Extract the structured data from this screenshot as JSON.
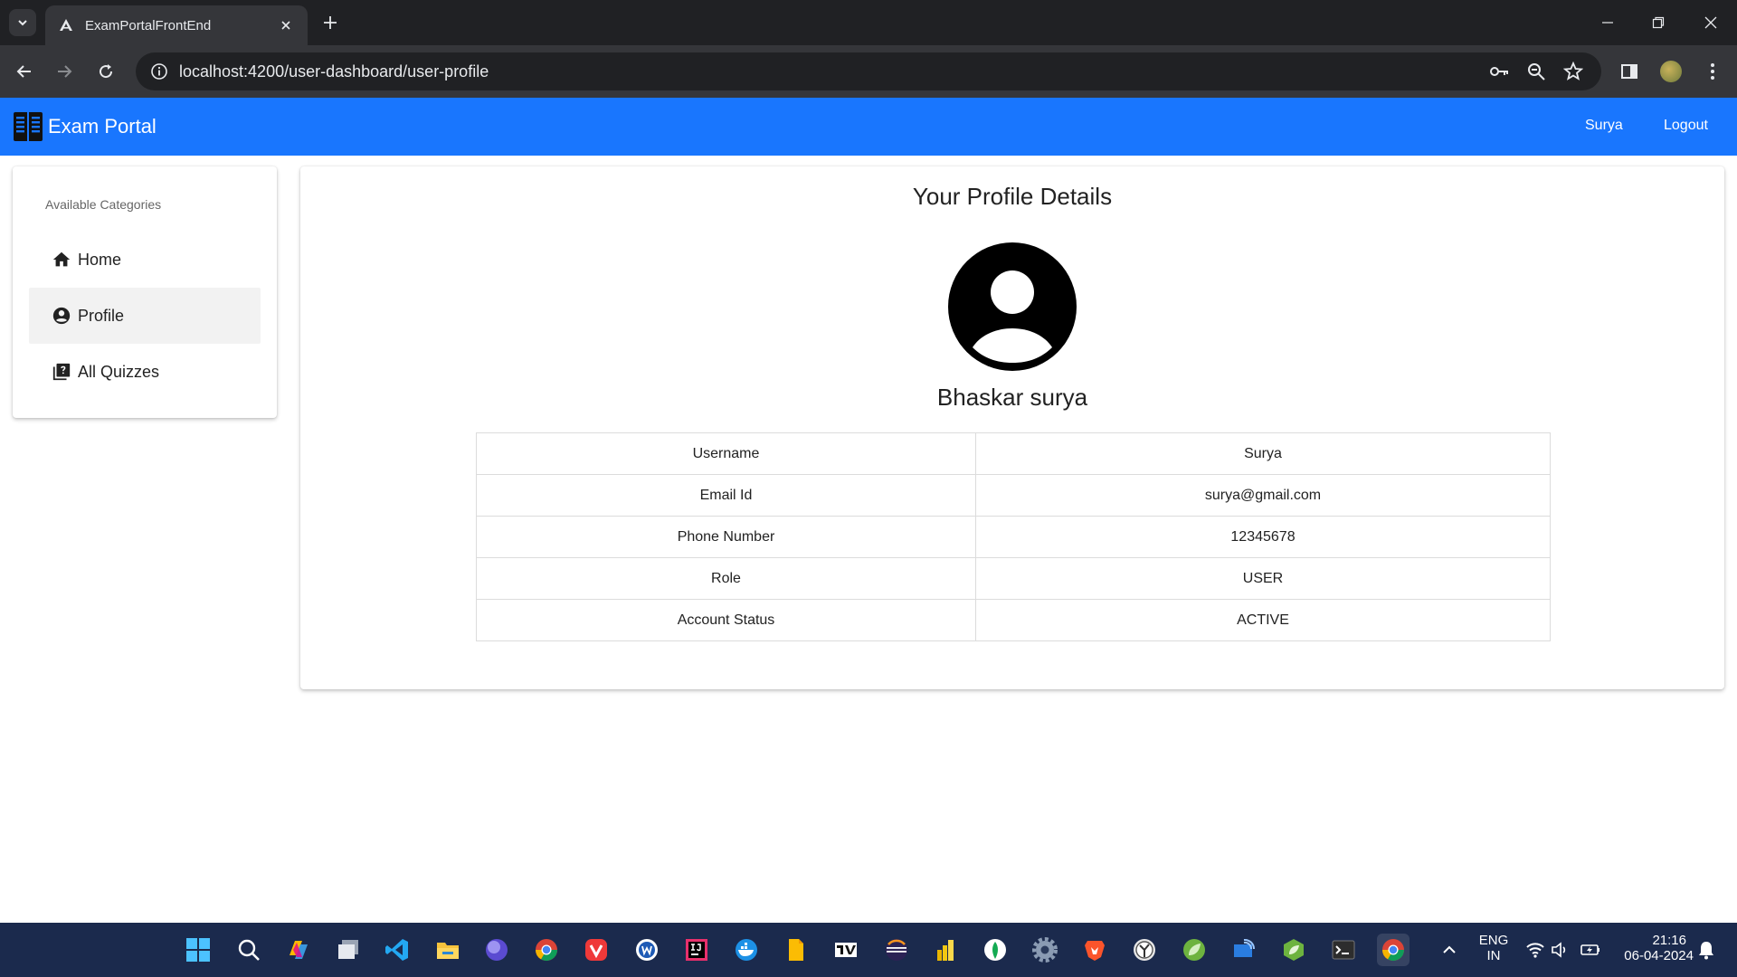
{
  "browser": {
    "tab_title": "ExamPortalFrontEnd",
    "url": "localhost:4200/user-dashboard/user-profile"
  },
  "app": {
    "brand": "Exam Portal",
    "header_links": [
      "Surya",
      "Logout"
    ],
    "accent": "#1976fe"
  },
  "sidebar": {
    "heading": "Available Categories",
    "items": [
      {
        "label": "Home",
        "icon": "home-icon"
      },
      {
        "label": "Profile",
        "icon": "account-circle-icon",
        "active": true
      },
      {
        "label": "All Quizzes",
        "icon": "quiz-icon"
      }
    ]
  },
  "profile": {
    "title": "Your Profile Details",
    "full_name": "Bhaskar surya",
    "rows": [
      {
        "label": "Username",
        "value": "Surya"
      },
      {
        "label": "Email Id",
        "value": "surya@gmail.com"
      },
      {
        "label": "Phone Number",
        "value": "12345678"
      },
      {
        "label": "Role",
        "value": "USER"
      },
      {
        "label": "Account Status",
        "value": "ACTIVE"
      }
    ]
  },
  "taskbar": {
    "language": "ENG",
    "region": "IN",
    "time": "21:16",
    "date": "06-04-2024"
  }
}
